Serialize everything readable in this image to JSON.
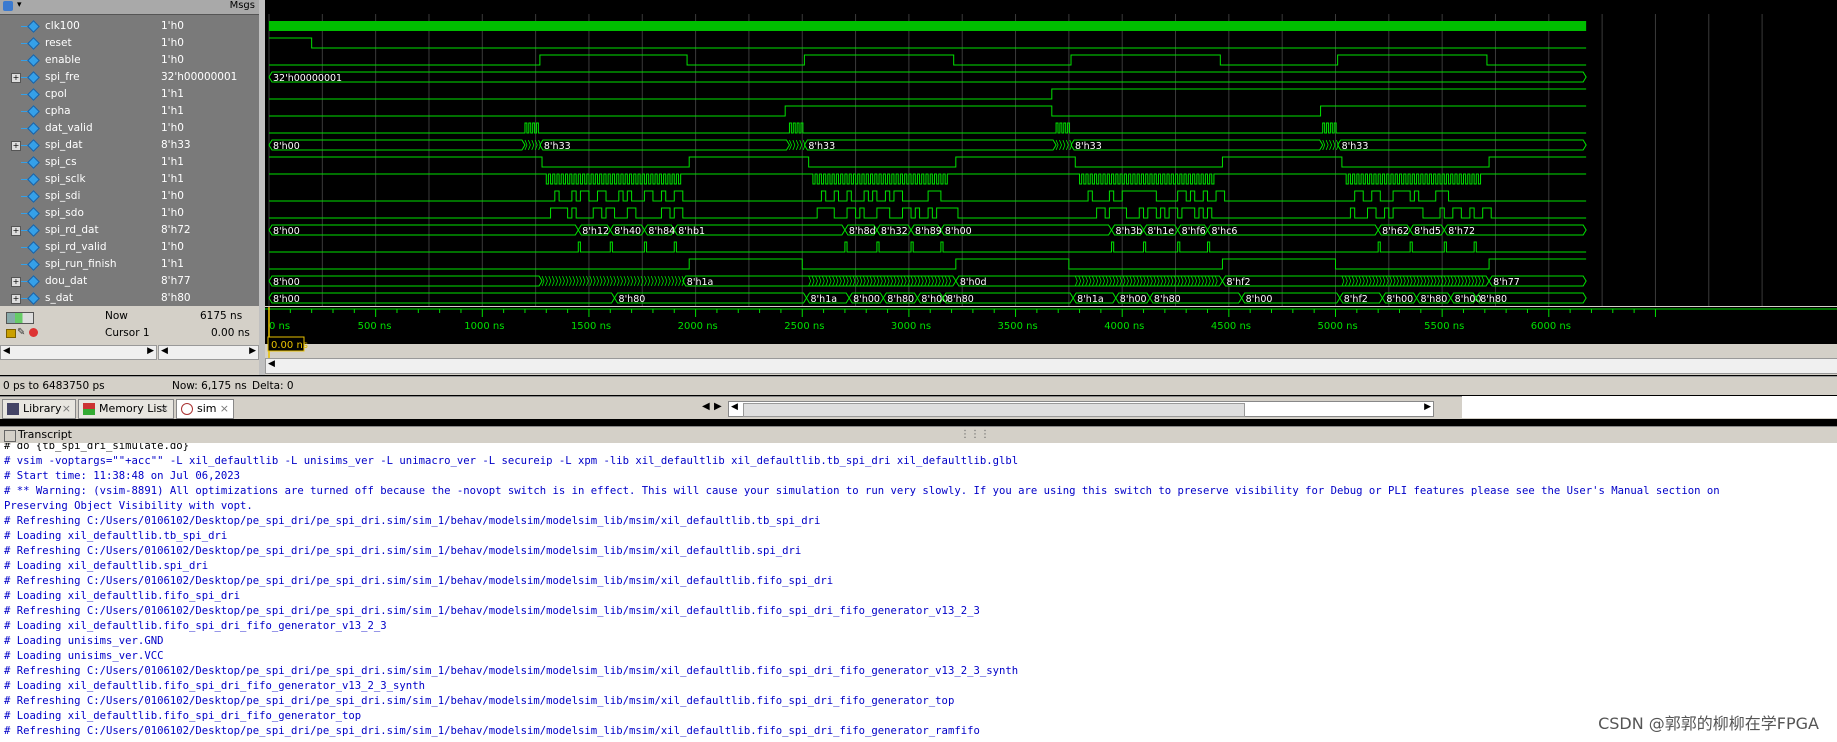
{
  "wave_header": {
    "msgs_label": "Msgs"
  },
  "signals": [
    {
      "name": "clk100",
      "value": "1'h0",
      "bus": false
    },
    {
      "name": "reset",
      "value": "1'h0",
      "bus": false
    },
    {
      "name": "enable",
      "value": "1'h0",
      "bus": false
    },
    {
      "name": "spi_fre",
      "value": "32'h00000001",
      "bus": true
    },
    {
      "name": "cpol",
      "value": "1'h1",
      "bus": false
    },
    {
      "name": "cpha",
      "value": "1'h1",
      "bus": false
    },
    {
      "name": "dat_valid",
      "value": "1'h0",
      "bus": false
    },
    {
      "name": "spi_dat",
      "value": "8'h33",
      "bus": true
    },
    {
      "name": "spi_cs",
      "value": "1'h1",
      "bus": false
    },
    {
      "name": "spi_sclk",
      "value": "1'h1",
      "bus": false
    },
    {
      "name": "spi_sdi",
      "value": "1'h0",
      "bus": false
    },
    {
      "name": "spi_sdo",
      "value": "1'h0",
      "bus": false
    },
    {
      "name": "spi_rd_dat",
      "value": "8'h72",
      "bus": true
    },
    {
      "name": "spi_rd_valid",
      "value": "1'h0",
      "bus": false
    },
    {
      "name": "spi_run_finish",
      "value": "1'h1",
      "bus": false
    },
    {
      "name": "dou_dat",
      "value": "8'h77",
      "bus": true
    },
    {
      "name": "s_dat",
      "value": "8'h80",
      "bus": true
    }
  ],
  "bus_labels": {
    "spi_fre": [
      "32'h00000001"
    ],
    "spi_dat": [
      "8'h00",
      "8'h33",
      "8'h33",
      "8'h33",
      "8'h33"
    ],
    "spi_rd_dat": [
      "8'h00",
      "8'h12",
      "8'h40",
      "8'h84",
      "8'hb1",
      "8'h8d",
      "8'h32",
      "8'h89",
      "8'h00",
      "8'h3b",
      "8'h1e",
      "8'hf6",
      "8'hc6",
      "8'h62",
      "8'hd5",
      "8'h72"
    ],
    "dou_dat": [
      "8'h00",
      "8'h1a",
      "8'h0d",
      "8'hf2",
      "8'h77"
    ],
    "s_dat": [
      "8'h00",
      "8'h80",
      "8'h1a",
      "8'h00",
      "8'h80",
      "8'h00",
      "8'h80",
      "8'h1a",
      "8'h00",
      "8'h80",
      "8'h00",
      "8'hf2",
      "8'h00",
      "8'h80",
      "8'h00",
      "8'h80"
    ]
  },
  "now": {
    "label": "Now",
    "value": "6175 ns"
  },
  "cursor": {
    "label": "Cursor 1",
    "value": "0.00 ns",
    "marker": "0.00 ns"
  },
  "time_axis": [
    "0 ns",
    "500 ns",
    "1000 ns",
    "1500 ns",
    "2000 ns",
    "2500 ns",
    "3000 ns",
    "3500 ns",
    "4000 ns",
    "4500 ns",
    "5000 ns",
    "5500 ns",
    "6000 ns"
  ],
  "status": {
    "range": "0 ps to 6483750 ps",
    "now": "Now: 6,175 ns",
    "delta": "Delta: 0"
  },
  "tabs": [
    {
      "label": "Library",
      "icon": "library-icon"
    },
    {
      "label": "Memory List",
      "icon": "memory-list-icon"
    },
    {
      "label": "sim",
      "icon": "sim-icon"
    }
  ],
  "transcript": {
    "title": "Transcript",
    "lines": [
      "# do {tb_spi_dri_simulate.do}",
      "# vsim -voptargs=\"\"+acc\"\" -L xil_defaultlib -L unisims_ver -L unimacro_ver -L secureip -L xpm -lib xil_defaultlib xil_defaultlib.tb_spi_dri xil_defaultlib.glbl",
      "# Start time: 11:38:48 on Jul 06,2023",
      "# ** Warning: (vsim-8891) All optimizations are turned off because the -novopt switch is in effect. This will cause your simulation to run very slowly. If you are using this switch to preserve visibility for Debug or PLI features please see the User's Manual section on",
      "Preserving Object Visibility with vopt.",
      "# Refreshing C:/Users/0106102/Desktop/pe_spi_dri/pe_spi_dri.sim/sim_1/behav/modelsim/modelsim_lib/msim/xil_defaultlib.tb_spi_dri",
      "# Loading xil_defaultlib.tb_spi_dri",
      "# Refreshing C:/Users/0106102/Desktop/pe_spi_dri/pe_spi_dri.sim/sim_1/behav/modelsim/modelsim_lib/msim/xil_defaultlib.spi_dri",
      "# Loading xil_defaultlib.spi_dri",
      "# Refreshing C:/Users/0106102/Desktop/pe_spi_dri/pe_spi_dri.sim/sim_1/behav/modelsim/modelsim_lib/msim/xil_defaultlib.fifo_spi_dri",
      "# Loading xil_defaultlib.fifo_spi_dri",
      "# Refreshing C:/Users/0106102/Desktop/pe_spi_dri/pe_spi_dri.sim/sim_1/behav/modelsim/modelsim_lib/msim/xil_defaultlib.fifo_spi_dri_fifo_generator_v13_2_3",
      "# Loading xil_defaultlib.fifo_spi_dri_fifo_generator_v13_2_3",
      "# Loading unisims_ver.GND",
      "# Loading unisims_ver.VCC",
      "# Refreshing C:/Users/0106102/Desktop/pe_spi_dri/pe_spi_dri.sim/sim_1/behav/modelsim/modelsim_lib/msim/xil_defaultlib.fifo_spi_dri_fifo_generator_v13_2_3_synth",
      "# Loading xil_defaultlib.fifo_spi_dri_fifo_generator_v13_2_3_synth",
      "# Refreshing C:/Users/0106102/Desktop/pe_spi_dri/pe_spi_dri.sim/sim_1/behav/modelsim/modelsim_lib/msim/xil_defaultlib.fifo_spi_dri_fifo_generator_top",
      "# Loading xil_defaultlib.fifo_spi_dri_fifo_generator_top",
      "# Refreshing C:/Users/0106102/Desktop/pe_spi_dri/pe_spi_dri.sim/sim_1/behav/modelsim/modelsim_lib/msim/xil_defaultlib.fifo_spi_dri_fifo_generator_ramfifo"
    ]
  },
  "watermark": "CSDN @郭郭的柳柳在学FPGA",
  "colors": {
    "wave": "#00e000",
    "background": "#000000",
    "panel": "#7a7a7a",
    "transcript_text": "#0000c8",
    "cursor": "#e8c000"
  }
}
